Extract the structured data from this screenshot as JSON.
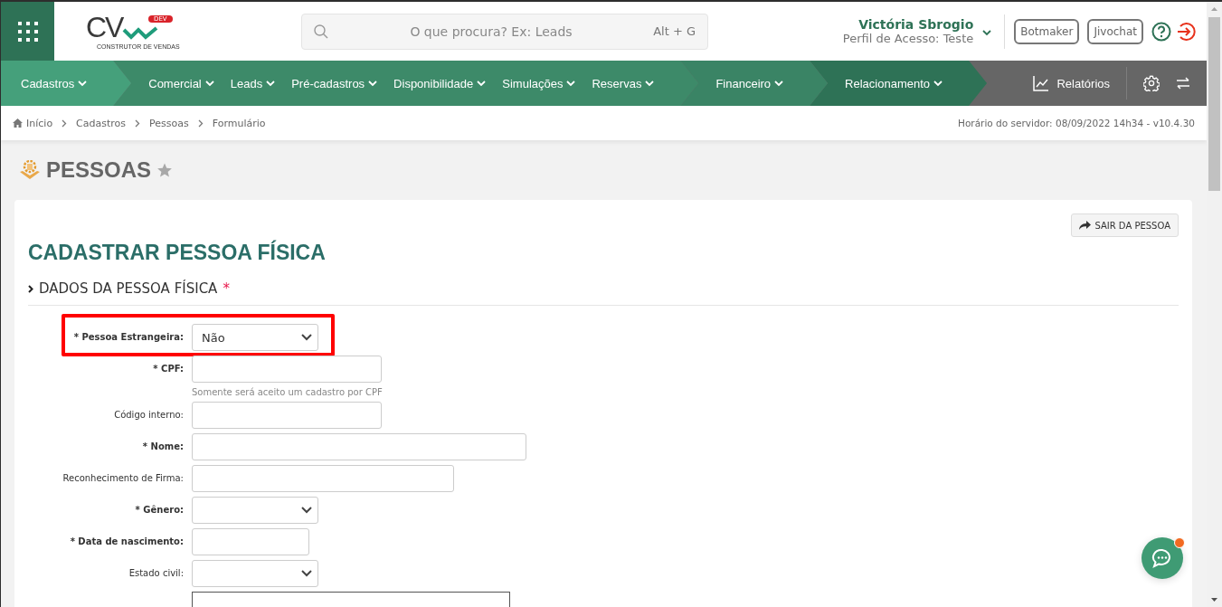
{
  "logo": {
    "letters": "CV",
    "badge": "DEV",
    "tagline": "CONSTRUTOR DE VENDAS"
  },
  "search": {
    "placeholder": "O que procura? Ex: Leads",
    "shortcut": "Alt + G"
  },
  "user": {
    "name": "Victória Sbrogio",
    "profile": "Perfil de Acesso: Teste"
  },
  "header_buttons": [
    "Botmaker",
    "Jivochat"
  ],
  "nav": {
    "groups": [
      {
        "color": "#45a07b",
        "items": [
          "Cadastros"
        ]
      },
      {
        "color": "#3d8a69",
        "items": [
          "Comercial",
          "Leads",
          "Pré-cadastros",
          "Disponibilidade",
          "Simulações",
          "Reservas"
        ]
      },
      {
        "color": "#3a8465",
        "items": [
          "Financeiro"
        ]
      },
      {
        "color": "#2e7256",
        "items": [
          "Relacionamento"
        ]
      }
    ],
    "reports": "Relatórios"
  },
  "breadcrumb": [
    "Início",
    "Cadastros",
    "Pessoas",
    "Formulário"
  ],
  "server_time": "Horário do servidor: 08/09/2022 14h34 - v10.4.30",
  "page": {
    "title": "PESSOAS"
  },
  "card": {
    "exit_button": "SAIR DA PESSOA",
    "heading": "CADASTRAR PESSOA FÍSICA",
    "section": {
      "title": "DADOS DA PESSOA FÍSICA",
      "mark": "*"
    }
  },
  "fields": [
    {
      "kind": "select",
      "label": "* Pessoa Estrangeira:",
      "required": true,
      "highlighted": true,
      "value": "Não"
    },
    {
      "kind": "text",
      "label": "* CPF:",
      "required": true,
      "highlighted": false,
      "hint": "Somente será aceito um cadastro por CPF"
    },
    {
      "kind": "text",
      "label": "Código interno:",
      "required": false,
      "highlighted": false
    },
    {
      "kind": "text",
      "label": "* Nome:",
      "required": true,
      "highlighted": false
    },
    {
      "kind": "text",
      "label": "Reconhecimento de Firma:",
      "required": false,
      "highlighted": false
    },
    {
      "kind": "select",
      "label": "* Gênero:",
      "required": true,
      "highlighted": false
    },
    {
      "kind": "text",
      "label": "* Data de nascimento:",
      "required": true,
      "highlighted": false
    },
    {
      "kind": "select",
      "label": "Estado civil:",
      "required": false,
      "highlighted": false
    },
    {
      "kind": "box"
    }
  ],
  "chat": {
    "unread": true
  }
}
